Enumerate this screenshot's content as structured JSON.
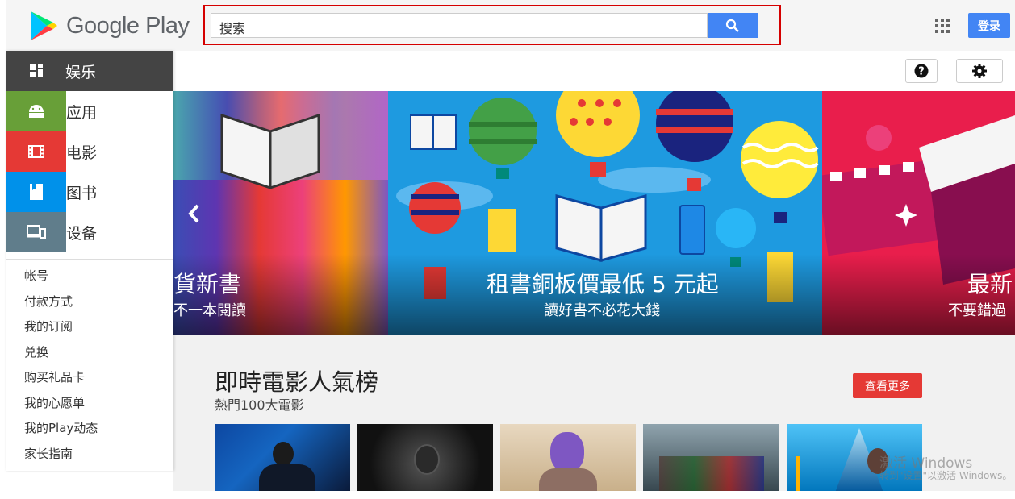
{
  "header": {
    "logo_text": "Google Play",
    "search_placeholder": "搜索",
    "login_label": "登录"
  },
  "sidebar": {
    "nav": [
      {
        "label": "娱乐",
        "icon": "apps-grid-icon"
      },
      {
        "label": "应用",
        "icon": "android-icon",
        "color": "#689f38"
      },
      {
        "label": "电影",
        "icon": "film-icon",
        "color": "#e53935"
      },
      {
        "label": "图书",
        "icon": "bookmark-icon",
        "color": "#0091ea"
      },
      {
        "label": "设备",
        "icon": "devices-icon",
        "color": "#607d8b"
      }
    ],
    "links": [
      "帐号",
      "付款方式",
      "我的订阅",
      "兑换",
      "购买礼品卡",
      "我的心愿单",
      "我的Play动态",
      "家长指南"
    ]
  },
  "carousel": {
    "slides": [
      {
        "title": "貨新書",
        "subtitle": "不一本閱讀"
      },
      {
        "title": "租書銅板價最低 5 元起",
        "subtitle": "讀好書不必花大錢"
      },
      {
        "title": "最新",
        "subtitle": "不要錯過"
      }
    ]
  },
  "section": {
    "title": "即時電影人氣榜",
    "subtitle": "熱門100大電影",
    "more_label": "查看更多",
    "thumbnails": [
      "movie-poster-1",
      "movie-poster-2",
      "movie-poster-3",
      "movie-poster-4",
      "movie-poster-5"
    ]
  },
  "watermark": {
    "line1": "激活 Windows",
    "line2": "转到\"设置\"以激活 Windows。"
  }
}
